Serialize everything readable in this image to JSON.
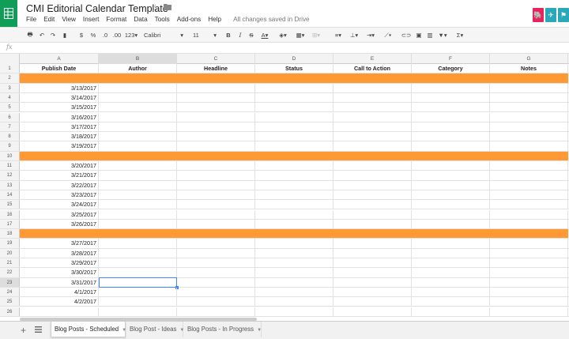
{
  "app": {
    "title": "CMI Editorial Calendar Template",
    "saved_status": "All changes saved in Drive"
  },
  "menu": [
    "File",
    "Edit",
    "View",
    "Insert",
    "Format",
    "Data",
    "Tools",
    "Add-ons",
    "Help"
  ],
  "toolbar": {
    "currency": "$",
    "percent": "%",
    "dec_decrease": ".0",
    "dec_increase": ".00",
    "more_formats": "123",
    "font": "Calibri",
    "font_size": "11",
    "bold": "B",
    "italic": "I",
    "strike": "S",
    "text_color": "A",
    "functions": "Σ"
  },
  "formula_bar": {
    "fx": "fx"
  },
  "columns": [
    "A",
    "B",
    "C",
    "D",
    "E",
    "F",
    "G"
  ],
  "header_row": [
    "Publish Date",
    "Author",
    "Headline",
    "Status",
    "Call to Action",
    "Category",
    "Notes"
  ],
  "rows": [
    {
      "n": "1",
      "type": "header"
    },
    {
      "n": "2",
      "type": "orange"
    },
    {
      "n": "3",
      "date": "3/13/2017"
    },
    {
      "n": "4",
      "date": "3/14/2017"
    },
    {
      "n": "5",
      "date": "3/15/2017"
    },
    {
      "n": "6",
      "date": "3/16/2017"
    },
    {
      "n": "7",
      "date": "3/17/2017"
    },
    {
      "n": "8",
      "date": "3/18/2017"
    },
    {
      "n": "9",
      "date": "3/19/2017"
    },
    {
      "n": "10",
      "type": "orange"
    },
    {
      "n": "11",
      "date": "3/20/2017"
    },
    {
      "n": "12",
      "date": "3/21/2017"
    },
    {
      "n": "13",
      "date": "3/22/2017"
    },
    {
      "n": "14",
      "date": "3/23/2017"
    },
    {
      "n": "15",
      "date": "3/24/2017"
    },
    {
      "n": "16",
      "date": "3/25/2017"
    },
    {
      "n": "17",
      "date": "3/26/2017"
    },
    {
      "n": "18",
      "type": "orange"
    },
    {
      "n": "19",
      "date": "3/27/2017"
    },
    {
      "n": "20",
      "date": "3/28/2017"
    },
    {
      "n": "21",
      "date": "3/29/2017"
    },
    {
      "n": "22",
      "date": "3/30/2017"
    },
    {
      "n": "23",
      "date": "3/31/2017",
      "selected": true
    },
    {
      "n": "24",
      "date": "4/1/2017"
    },
    {
      "n": "25",
      "date": "4/2/2017"
    },
    {
      "n": "26",
      "date": ""
    }
  ],
  "selected_cell": "B23",
  "sheets": [
    {
      "label": "Blog Posts - Scheduled",
      "active": true
    },
    {
      "label": "Blog Post - Ideas",
      "active": false
    },
    {
      "label": "Blog Posts - In Progress",
      "active": false
    }
  ],
  "colors": {
    "band": "#ff9933",
    "app_green": "#0f9d58",
    "selection": "#4285f4"
  }
}
